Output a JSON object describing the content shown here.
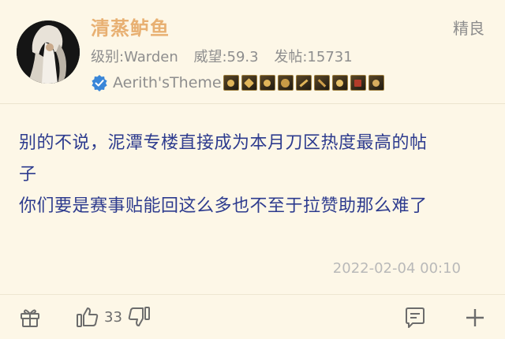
{
  "post": {
    "username": "清蒸鲈鱼",
    "grade": "精良",
    "level": "级别:Warden",
    "prestige": "威望:59.3",
    "posts": "发帖:15731",
    "theme_name": "Aerith'sTheme",
    "content_lines": [
      "别的不说，泥潭专楼直接成为本月刀区热度最高的帖",
      "子",
      "你们要是赛事贴能回这么多也不至于拉赞助那么难了"
    ],
    "timestamp": "2022-02-04 00:10"
  },
  "actions": {
    "like_count": "33"
  },
  "colors": {
    "background": "#fdf7e7",
    "username": "#e8b072",
    "content_text": "#2d3b8e",
    "verify_badge": "#3a86d8"
  },
  "icons": [
    "gift-icon",
    "thumbs-up-icon",
    "thumbs-down-icon",
    "comment-icon",
    "plus-icon",
    "verified-icon"
  ]
}
